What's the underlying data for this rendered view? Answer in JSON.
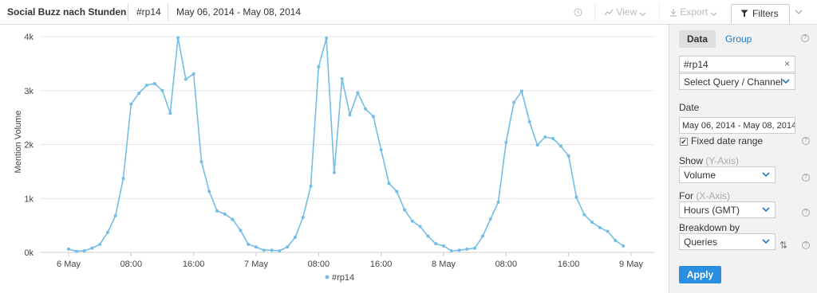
{
  "toolbar": {
    "title": "Social Buzz nach Stunden",
    "query": "#rp14",
    "date_range": "May 06, 2014 - May 08, 2014",
    "view_label": "View",
    "export_label": "Export",
    "filters_label": "Filters"
  },
  "panel": {
    "tab_data": "Data",
    "tab_group": "Group",
    "query_value": "#rp14",
    "query_clear": "×",
    "select_query_label": "Select Query / Channel",
    "date_label": "Date",
    "date_value": "May 06, 2014 - May 08, 2014",
    "fixed_date_label": "Fixed date range",
    "fixed_date_checked": "✔",
    "show_label": "Show",
    "show_hint": "(Y-Axis)",
    "show_value": "Volume",
    "for_label": "For",
    "for_hint": "(X-Axis)",
    "for_value": "Hours (GMT)",
    "breakdown_label": "Breakdown by",
    "breakdown_value": "Queries",
    "apply_label": "Apply",
    "swap_glyph": "⇅",
    "help_glyph": "?"
  },
  "colors": {
    "series": "#74bde6",
    "grid": "#e6e6e6",
    "accent": "#2a8fe0",
    "link": "#1f7bc6"
  },
  "chart_data": {
    "type": "line",
    "ylabel": "Mention Volume",
    "ylim": [
      0,
      4000
    ],
    "y_ticks": [
      "0k",
      "1k",
      "2k",
      "3k",
      "4k"
    ],
    "x_ticks": [
      "6 May",
      "08:00",
      "16:00",
      "7 May",
      "08:00",
      "16:00",
      "8 May",
      "08:00",
      "16:00",
      "9 May"
    ],
    "x_range_hours": [
      0,
      72
    ],
    "grid": true,
    "legend": "bottom-center",
    "series": [
      {
        "name": "#rp14",
        "x_hours": [
          0,
          1,
          2,
          3,
          4,
          5,
          6,
          7,
          8,
          9,
          10,
          11,
          12,
          13,
          14,
          15,
          16,
          17,
          18,
          19,
          20,
          21,
          22,
          23,
          24,
          25,
          26,
          27,
          28,
          29,
          30,
          31,
          32,
          33,
          34,
          35,
          36,
          37,
          38,
          39,
          40,
          41,
          42,
          43,
          44,
          45,
          46,
          47,
          48,
          49,
          50,
          51,
          52,
          53,
          54,
          55,
          56,
          57,
          58,
          59,
          60,
          61,
          62,
          63,
          64,
          65,
          66,
          67,
          68,
          69,
          70,
          71
        ],
        "values": [
          60,
          20,
          30,
          80,
          150,
          370,
          680,
          1370,
          2750,
          2950,
          3100,
          3130,
          3000,
          2580,
          3980,
          3210,
          3310,
          1680,
          1130,
          770,
          710,
          610,
          410,
          150,
          100,
          40,
          40,
          30,
          100,
          280,
          650,
          1230,
          3440,
          3970,
          1480,
          3220,
          2550,
          2960,
          2660,
          2520,
          1900,
          1280,
          1130,
          790,
          580,
          480,
          300,
          160,
          120,
          30,
          40,
          60,
          80,
          300,
          620,
          930,
          2040,
          2780,
          2990,
          2420,
          1990,
          2140,
          2110,
          1970,
          1790,
          1020,
          700,
          560,
          460,
          390,
          220,
          120
        ]
      }
    ]
  }
}
